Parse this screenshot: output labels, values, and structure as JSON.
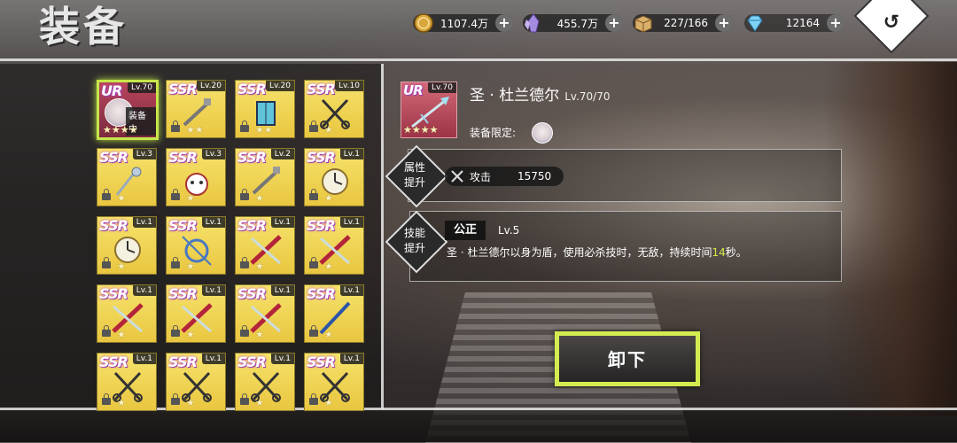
{
  "header": {
    "title": "装备"
  },
  "resources": [
    {
      "icon": "gold-coin-icon",
      "value": "1107.4万"
    },
    {
      "icon": "crystal-icon",
      "value": "455.7万"
    },
    {
      "icon": "box-icon",
      "value": "227/166"
    },
    {
      "icon": "diamond-icon",
      "value": "12164"
    }
  ],
  "back": {
    "icon": "back-arrow-icon"
  },
  "inventory": [
    {
      "rarity": "UR",
      "level": "Lv.70",
      "tag": "装备中",
      "stars": 4,
      "locked": false
    },
    {
      "rarity": "SSR",
      "level": "Lv.20",
      "stars": 2,
      "locked": true
    },
    {
      "rarity": "SSR",
      "level": "Lv.20",
      "stars": 2,
      "locked": true
    },
    {
      "rarity": "SSR",
      "level": "Lv.10",
      "stars": 1,
      "locked": true
    },
    {
      "rarity": "SSR",
      "level": "Lv.3",
      "stars": 1,
      "locked": true
    },
    {
      "rarity": "SSR",
      "level": "Lv.3",
      "stars": 1,
      "locked": true
    },
    {
      "rarity": "SSR",
      "level": "Lv.2",
      "stars": 1,
      "locked": true
    },
    {
      "rarity": "SSR",
      "level": "Lv.1",
      "stars": 1,
      "locked": true
    },
    {
      "rarity": "SSR",
      "level": "Lv.1",
      "stars": 1,
      "locked": true
    },
    {
      "rarity": "SSR",
      "level": "Lv.1",
      "stars": 1,
      "locked": true
    },
    {
      "rarity": "SSR",
      "level": "Lv.1",
      "stars": 1,
      "locked": true
    },
    {
      "rarity": "SSR",
      "level": "Lv.1",
      "stars": 1,
      "locked": true
    },
    {
      "rarity": "SSR",
      "level": "Lv.1",
      "stars": 1,
      "locked": true
    },
    {
      "rarity": "SSR",
      "level": "Lv.1",
      "stars": 1,
      "locked": true
    },
    {
      "rarity": "SSR",
      "level": "Lv.1",
      "stars": 1,
      "locked": true
    },
    {
      "rarity": "SSR",
      "level": "Lv.1",
      "stars": 1,
      "locked": true
    },
    {
      "rarity": "SSR",
      "level": "Lv.1",
      "stars": 1,
      "locked": true
    },
    {
      "rarity": "SSR",
      "level": "Lv.1",
      "stars": 1,
      "locked": true
    },
    {
      "rarity": "SSR",
      "level": "Lv.1",
      "stars": 1,
      "locked": true
    },
    {
      "rarity": "SSR",
      "level": "Lv.1",
      "stars": 1,
      "locked": true
    }
  ],
  "detail": {
    "rarity": "UR",
    "level": "Lv.70",
    "name": "圣 · 杜兰德尔",
    "level_range": "Lv.70/70",
    "stars": 4,
    "limit_label": "装备限定:",
    "attr_tag": "属性\n提升",
    "stat_label": "攻击",
    "stat_value": "15750",
    "skill_tag": "技能\n提升",
    "skill_name": "公正",
    "skill_level": "Lv.5",
    "skill_desc_pre": "圣 · 杜兰德尔以身为盾，使用必杀技时，无敌，持续时间",
    "skill_desc_num": "14",
    "skill_desc_post": "秒。"
  },
  "actions": {
    "unequip_label": "卸下"
  },
  "colors": {
    "accent": "#d4ec50",
    "card": "#f0d75a",
    "ur": "#a53a50"
  }
}
